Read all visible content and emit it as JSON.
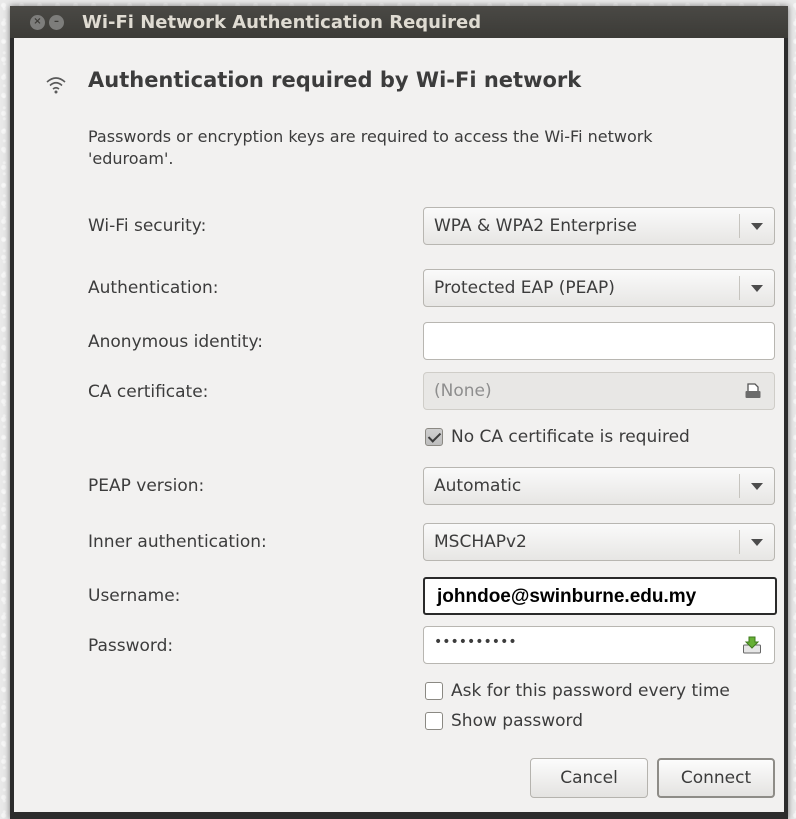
{
  "window": {
    "title": "Wi-Fi Network Authentication Required"
  },
  "dialog": {
    "heading": "Authentication required by Wi-Fi network",
    "description": "Passwords or encryption keys are required to access the Wi-Fi network 'eduroam'.",
    "icons": {
      "wifi": "wifi-icon",
      "certificate": "document-icon",
      "key": "key-icon"
    }
  },
  "form": {
    "wifi_security": {
      "label": "Wi-Fi security:",
      "value": "WPA & WPA2 Enterprise"
    },
    "authentication": {
      "label": "Authentication:",
      "value": "Protected EAP (PEAP)"
    },
    "anonymous_identity": {
      "label": "Anonymous identity:",
      "value": ""
    },
    "ca_certificate": {
      "label": "CA certificate:",
      "value": "(None)"
    },
    "no_ca_required": {
      "label": "No CA certificate is required",
      "checked": true
    },
    "peap_version": {
      "label": "PEAP version:",
      "value": "Automatic"
    },
    "inner_authentication": {
      "label": "Inner authentication:",
      "value": "MSCHAPv2"
    },
    "username": {
      "label": "Username:",
      "value": "johndoe@swinburne.edu.my"
    },
    "password": {
      "label": "Password:",
      "value": "••••••••••"
    },
    "ask_password": {
      "label": "Ask for this password every time",
      "checked": false
    },
    "show_password": {
      "label": "Show password",
      "checked": false
    }
  },
  "buttons": {
    "cancel": "Cancel",
    "connect": "Connect"
  },
  "colors": {
    "titlebar": "#3c3b37",
    "dialog_bg": "#f2f1f0",
    "text": "#3c3c3c"
  }
}
